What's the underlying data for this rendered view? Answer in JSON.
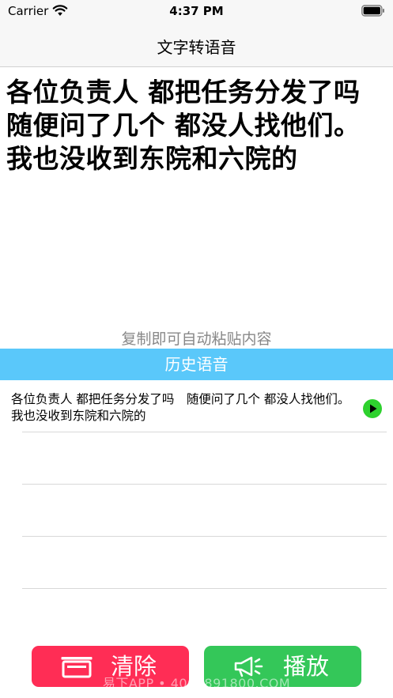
{
  "status_bar": {
    "carrier": "Carrier",
    "time": "4:37 PM",
    "icons": [
      "wifi-icon",
      "battery-icon"
    ]
  },
  "nav": {
    "title": "文字转语音"
  },
  "main": {
    "text": "各位负责人 都把任务分发了吗 随便问了几个 都没人找他们。 我也没收到东院和六院的",
    "paste_hint": "复制即可自动粘贴内容"
  },
  "history": {
    "header": "历史语音",
    "items": [
      {
        "text": "各位负责人 都把任务分发了吗　随便问了几个 都没人找他们。 我也没收到东院和六院的",
        "icon": "play-circle-icon"
      },
      {
        "text": "",
        "icon": ""
      },
      {
        "text": "",
        "icon": ""
      },
      {
        "text": "",
        "icon": ""
      }
    ]
  },
  "buttons": {
    "clear_label": "清除",
    "play_label": "播放"
  },
  "watermark": "易下APP • 4000891800.COM",
  "colors": {
    "bar_bg": "#f7f7f7",
    "history_header": "#5ac8fa",
    "clear_button": "#ff2d55",
    "play_button": "#34c759",
    "hint_text": "#888888"
  }
}
